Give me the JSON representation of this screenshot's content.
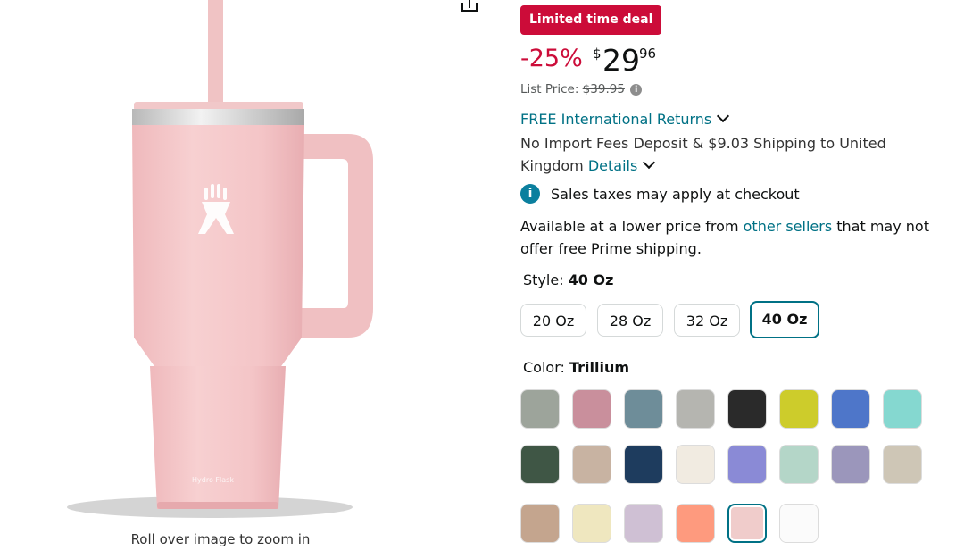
{
  "product_image": {
    "zoom_hint": "Roll over image to zoom in",
    "brand_mark": "Hydro Flask",
    "color": "#f4c7c8"
  },
  "deal": {
    "badge": "Limited time deal",
    "badge_color": "#cc0c39"
  },
  "price": {
    "discount": "-25%",
    "currency": "$",
    "whole": "29",
    "fraction": "96",
    "list_label": "List Price:",
    "list_value": "$39.95"
  },
  "shipping": {
    "returns_link": "FREE International Returns",
    "import_text": "No Import Fees Deposit & $9.03 Shipping to United Kingdom",
    "details_link": "Details"
  },
  "tax": {
    "text": "Sales taxes may apply at checkout"
  },
  "lower_price": {
    "prefix": "Available at a lower price from",
    "link": "other sellers",
    "suffix": "that may not offer free Prime shipping."
  },
  "style": {
    "label": "Style:",
    "selected": "40 Oz",
    "options": [
      "20 Oz",
      "28 Oz",
      "32 Oz",
      "40 Oz"
    ]
  },
  "color": {
    "label": "Color:",
    "selected": "Trillium",
    "swatches": [
      "#9da49b",
      "#c98f9c",
      "#6e8d99",
      "#b5b5b0",
      "#2a2a2a",
      "#cdcc2b",
      "#4e76c9",
      "#85d8d0",
      "#3f5645",
      "#c8b3a2",
      "#1e3c5e",
      "#f1ebe1",
      "#8a8ad6",
      "#b4d6c8",
      "#9b96bb",
      "#cec6b6",
      "#c4a58e",
      "#efe7bf",
      "#cfc0d4",
      "#fe9a7e",
      "#f0cccb",
      "#fbfbfb"
    ],
    "selected_index": 20
  }
}
